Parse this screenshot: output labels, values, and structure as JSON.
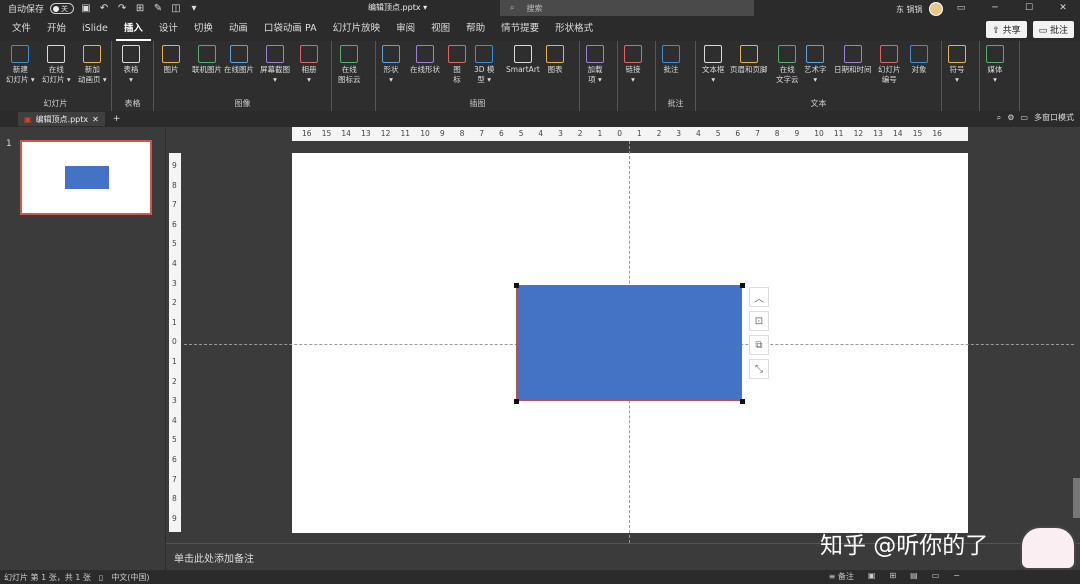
{
  "titlebar": {
    "autosave_label": "自动保存",
    "autosave_state": "关",
    "doc_title": "编辑顶点.pptx ▾",
    "search_placeholder": "搜索",
    "user_name": "东 锅锅"
  },
  "menu": {
    "tabs": [
      "文件",
      "开始",
      "iSlide",
      "插入",
      "设计",
      "切换",
      "动画",
      "口袋动画 PA",
      "幻灯片放映",
      "审阅",
      "视图",
      "帮助",
      "情节提要",
      "形状格式"
    ],
    "active_index": 3,
    "share": "共享",
    "comment": "批注"
  },
  "ribbon": {
    "groups": [
      {
        "label": "幻灯片",
        "buttons": [
          "新建\n幻灯片 ▾",
          "在线\n幻灯片 ▾",
          "新加\n动画页 ▾"
        ]
      },
      {
        "label": "表格",
        "buttons": [
          "表格\n▾"
        ]
      },
      {
        "label": "图像",
        "buttons": [
          "图片",
          "联机图片",
          "在线图片",
          "屏幕截图\n▾",
          "相册\n▾"
        ]
      },
      {
        "label": "",
        "buttons": [
          "在线\n图标云"
        ]
      },
      {
        "label": "插图",
        "buttons": [
          "形状\n▾",
          "在线形状",
          "图\n标",
          "3D 模\n型 ▾",
          "SmartArt",
          "图表"
        ]
      },
      {
        "label": "",
        "buttons": [
          "加载\n项 ▾"
        ]
      },
      {
        "label": "",
        "buttons": [
          "链接\n▾"
        ]
      },
      {
        "label": "批注",
        "buttons": [
          "批注"
        ]
      },
      {
        "label": "文本",
        "buttons": [
          "文本框\n▾",
          "页眉和页脚",
          "在线\n文字云",
          "艺术字\n▾",
          "日期和时间",
          "幻灯片\n编号",
          "对象"
        ]
      },
      {
        "label": "",
        "buttons": [
          "符号\n▾"
        ]
      },
      {
        "label": "",
        "buttons": [
          "媒体\n▾"
        ]
      }
    ]
  },
  "docbar": {
    "tab_name": "编辑顶点.pptx",
    "multi_window": "多窗口模式"
  },
  "thumbnails": {
    "slide_number": "1"
  },
  "rulers": {
    "h_ticks": [
      "16",
      "15",
      "14",
      "13",
      "12",
      "11",
      "10",
      "9",
      "8",
      "7",
      "6",
      "5",
      "4",
      "3",
      "2",
      "1",
      "0",
      "1",
      "2",
      "3",
      "4",
      "5",
      "6",
      "7",
      "8",
      "9",
      "10",
      "11",
      "12",
      "13",
      "14",
      "15",
      "16"
    ],
    "v_ticks": [
      "9",
      "8",
      "7",
      "6",
      "5",
      "4",
      "3",
      "2",
      "1",
      "0",
      "1",
      "2",
      "3",
      "4",
      "5",
      "6",
      "7",
      "8",
      "9"
    ]
  },
  "notes": {
    "placeholder": "单击此处添加备注"
  },
  "watermark": "知乎 @听你的了",
  "status": {
    "slide_info": "幻灯片 第 1 张，共 1 张",
    "language": "中文(中国)",
    "notes_btn": "备注"
  },
  "colors": {
    "shape_fill": "#4472c4",
    "shape_border": "#c0504d",
    "thumb_selected": "#d2564a"
  }
}
